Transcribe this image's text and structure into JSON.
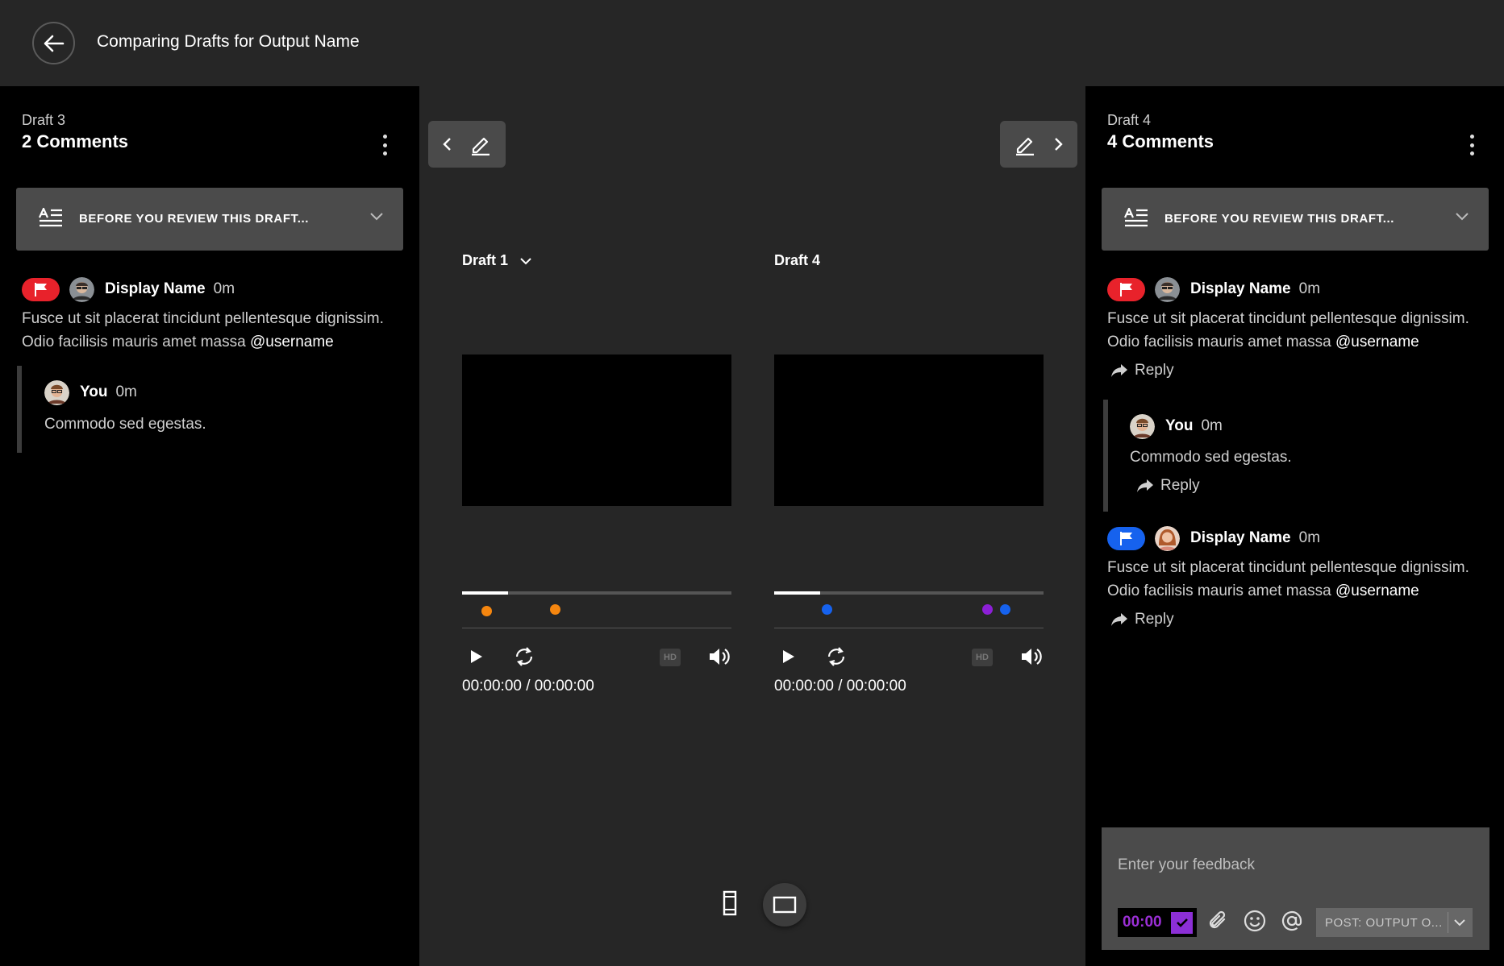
{
  "header": {
    "title": "Comparing Drafts for Output Name"
  },
  "review_banner": {
    "label": "BEFORE YOU REVIEW THIS DRAFT..."
  },
  "left_panel": {
    "draft_label": "Draft 3",
    "comment_count": "2 Comments",
    "comments": [
      {
        "name": "Display Name",
        "time": "0m",
        "text_line1": "Fusce ut sit placerat tincidunt pellentesque dignissim.",
        "text_line2": "Odio facilisis mauris amet massa ",
        "mention": "@username"
      }
    ],
    "reply": {
      "name": "You",
      "time": "0m",
      "text": "Commodo sed egestas."
    }
  },
  "right_panel": {
    "draft_label": "Draft 4",
    "comment_count": "4 Comments",
    "reply_label": "Reply",
    "comments": [
      {
        "name": "Display Name",
        "time": "0m",
        "text_line1": "Fusce ut sit placerat tincidunt pellentesque dignissim.",
        "text_line2": "Odio facilisis mauris amet massa ",
        "mention": "@username"
      },
      {
        "name": "Display Name",
        "time": "0m",
        "text_line1": "Fusce ut sit placerat tincidunt pellentesque dignissim.",
        "text_line2": "Odio facilisis mauris amet massa ",
        "mention": "@username"
      }
    ],
    "reply": {
      "name": "You",
      "time": "0m",
      "text": "Commodo sed egestas."
    }
  },
  "players": [
    {
      "title": "Draft 1",
      "timecode": "00:00:00 / 00:00:00",
      "hd": "HD",
      "progress": 0.17,
      "markers": [
        {
          "pos": 0.09,
          "color": "#f5860f"
        },
        {
          "pos": 0.345,
          "color": "#f5860f"
        }
      ]
    },
    {
      "title": "Draft 4",
      "timecode": "00:00:00 / 00:00:00",
      "hd": "HD",
      "progress": 0.17,
      "markers": [
        {
          "pos": 0.195,
          "color": "#1662ee"
        },
        {
          "pos": 0.79,
          "color": "#8c1fd6"
        },
        {
          "pos": 0.855,
          "color": "#1662ee"
        }
      ]
    }
  ],
  "feedback": {
    "placeholder": "Enter your feedback",
    "timestamp": "00:00",
    "post_label": "POST: OUTPUT O..."
  },
  "colors": {
    "flag_red": "#e8222b",
    "flag_blue": "#1662ee",
    "accent_purple": "#8c2fd6",
    "marker_orange": "#f5860f"
  }
}
